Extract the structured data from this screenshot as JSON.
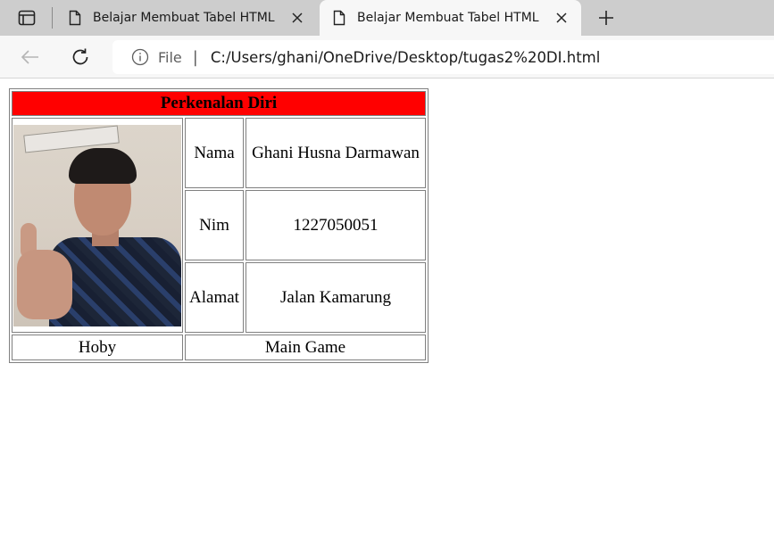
{
  "browser": {
    "tabs": [
      {
        "title": "Belajar Membuat Tabel HTML",
        "active": false
      },
      {
        "title": "Belajar Membuat Tabel HTML",
        "active": true
      }
    ],
    "address": {
      "scheme_label": "File",
      "separator": "|",
      "url": "C:/Users/ghani/OneDrive/Desktop/tugas2%20DI.html"
    },
    "icons": {
      "tab_actions": "tab-actions-icon",
      "page": "page-icon",
      "close": "close-icon",
      "new_tab": "plus-icon",
      "back": "back-arrow-icon",
      "reload": "reload-icon",
      "info": "info-icon"
    }
  },
  "page": {
    "header": "Perkenalan Diri",
    "header_color": "#ff0000",
    "rows": [
      {
        "label": "Nama",
        "value": "Ghani Husna Darmawan"
      },
      {
        "label": "Nim",
        "value": "1227050051"
      },
      {
        "label": "Alamat",
        "value": "Jalan Kamarung"
      }
    ],
    "footer": {
      "label": "Hoby",
      "value": "Main Game"
    }
  }
}
